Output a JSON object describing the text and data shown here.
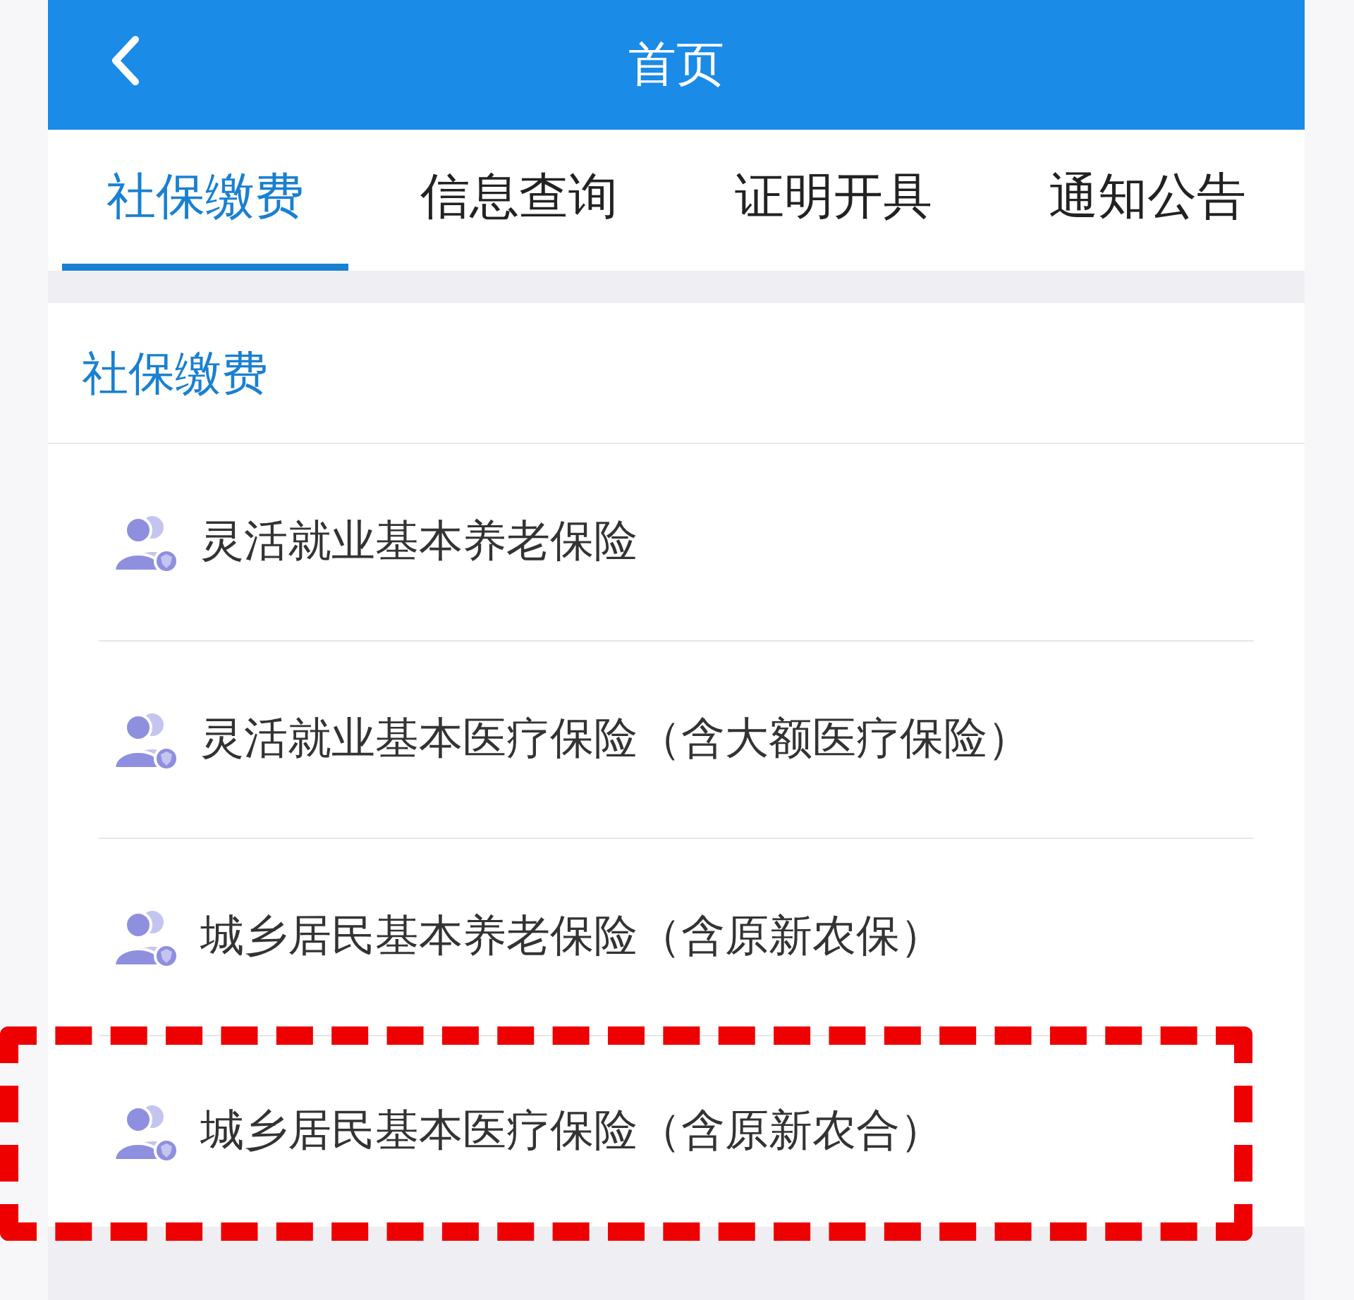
{
  "header": {
    "title": "首页"
  },
  "tabs": [
    {
      "label": "社保缴费",
      "selected": true
    },
    {
      "label": "信息查询",
      "selected": false
    },
    {
      "label": "证明开具",
      "selected": false
    },
    {
      "label": "通知公告",
      "selected": false
    }
  ],
  "section": {
    "title": "社保缴费",
    "items": [
      {
        "label": "灵活就业基本养老保险",
        "highlighted": false
      },
      {
        "label": "灵活就业基本医疗保险（含大额医疗保险）",
        "highlighted": false
      },
      {
        "label": "城乡居民基本养老保险（含原新农保）",
        "highlighted": false
      },
      {
        "label": "城乡居民基本医疗保险（含原新农合）",
        "highlighted": true
      }
    ]
  }
}
